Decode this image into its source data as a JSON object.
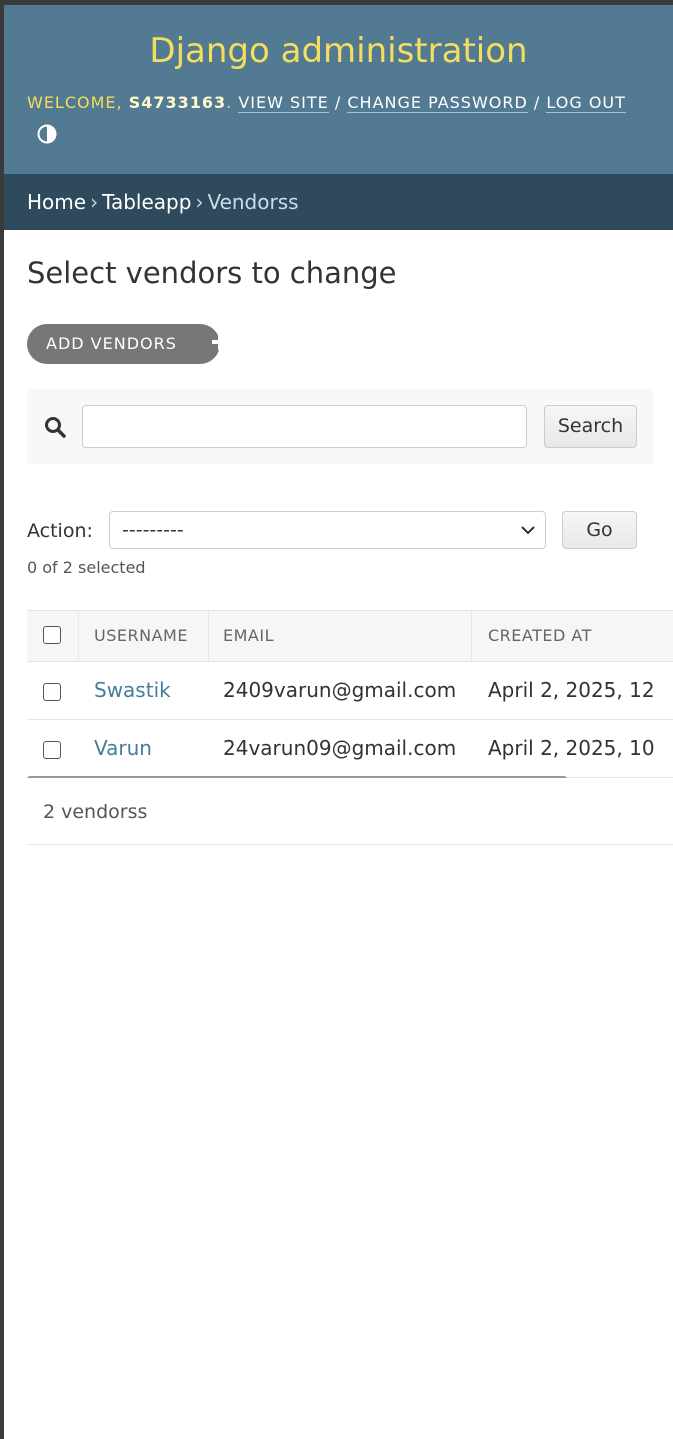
{
  "header": {
    "site_title": "Django administration",
    "welcome": "WELCOME,",
    "username": "S4733163",
    "after_username": ".",
    "view_site": "VIEW SITE",
    "change_password": "CHANGE PASSWORD",
    "log_out": "LOG OUT",
    "separator": "/",
    "theme_toggle_icon": "contrast-icon"
  },
  "breadcrumbs": {
    "items": [
      "Home",
      "Tableapp",
      "Vendorss"
    ],
    "separator": "›"
  },
  "main": {
    "title": "Select vendors to change",
    "add_button": "ADD VENDORS",
    "search": {
      "value": "",
      "placeholder": "",
      "button": "Search"
    },
    "actions": {
      "label": "Action:",
      "selected_option": "---------",
      "go_button": "Go",
      "selected_count": "0 of 2 selected"
    },
    "table": {
      "columns": [
        "USERNAME",
        "EMAIL",
        "CREATED AT"
      ],
      "rows": [
        {
          "username": "Swastik",
          "email": "2409varun@gmail.com",
          "created_at": "April 2, 2025, 12"
        },
        {
          "username": "Varun",
          "email": "24varun09@gmail.com",
          "created_at": "April 2, 2025, 10"
        }
      ]
    },
    "paginator": "2 vendorss"
  },
  "colors": {
    "header_bg": "#527a93",
    "breadcrumbs_bg": "#2f4a5c",
    "accent_yellow": "#f5dd5d",
    "link": "#447e9b"
  }
}
